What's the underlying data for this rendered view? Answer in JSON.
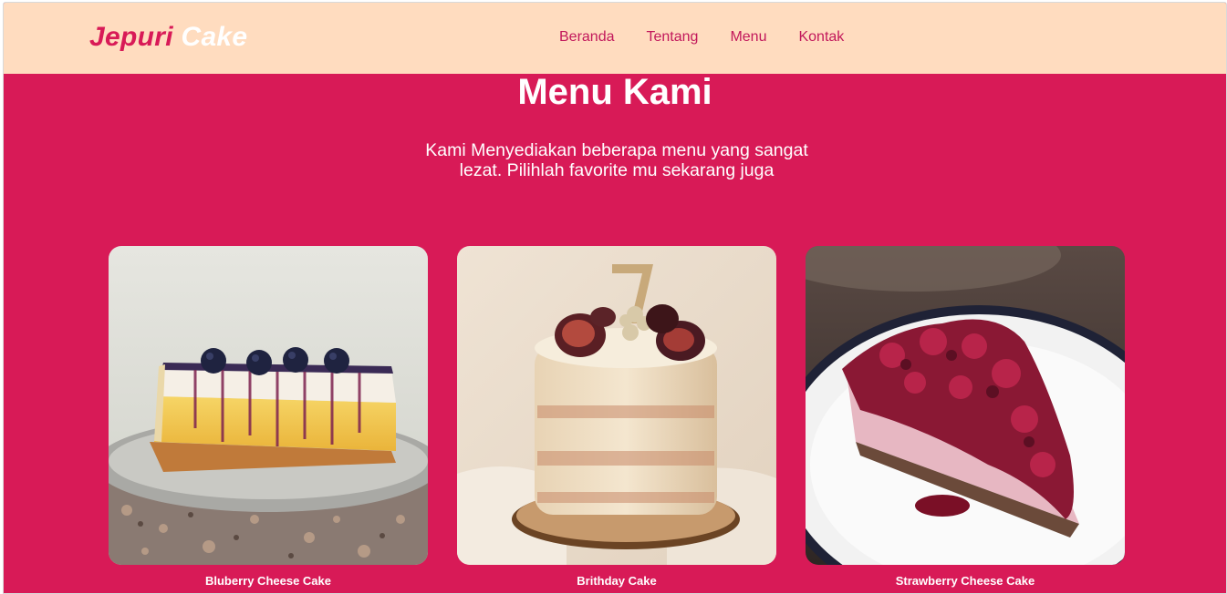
{
  "brand": {
    "part1": "Jepuri",
    "part2": "Cake"
  },
  "nav": {
    "items": [
      {
        "label": "Beranda"
      },
      {
        "label": "Tentang"
      },
      {
        "label": "Menu"
      },
      {
        "label": "Kontak"
      }
    ]
  },
  "hero": {
    "title": "Menu Kami",
    "subtitle": "Kami Menyediakan beberapa menu yang sangat lezat. Pilihlah favorite mu sekarang juga"
  },
  "menu": {
    "items": [
      {
        "name": "Bluberry Cheese Cake"
      },
      {
        "name": "Brithday Cake"
      },
      {
        "name": "Strawberry Cheese Cake"
      }
    ]
  },
  "colors": {
    "primary": "#d81a57",
    "navbar_bg": "#ffdcbf",
    "nav_link": "#c2185b",
    "text_light": "#ffffff"
  }
}
